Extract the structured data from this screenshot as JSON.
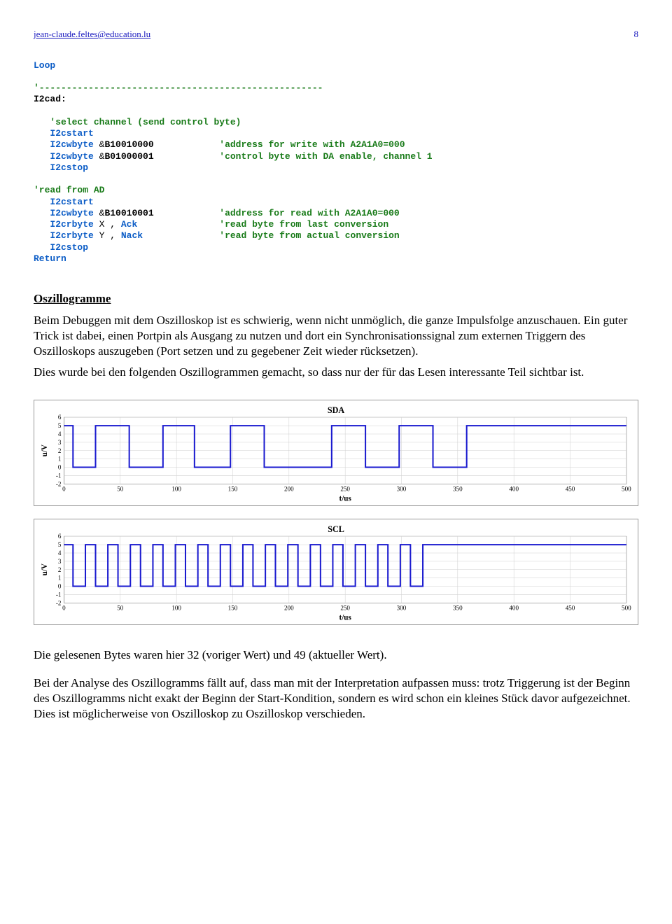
{
  "header": {
    "author_link": "jean-claude.feltes@education.lu",
    "page_number": "8"
  },
  "code": {
    "loop": "Loop",
    "dash": "'----------------------------------------------------",
    "lbl_i2cad": "I2cad:",
    "cmt_select": "'select channel (send control byte)",
    "i2cstart": "I2cstart",
    "i2cwbyte": "I2cwbyte",
    "b1": "B10010000",
    "cmt_addr_w": "'address for write with A2A1A0=000",
    "b2": "B01000001",
    "cmt_ctrl": "'control byte with DA enable, channel 1",
    "i2cstop": "I2cstop",
    "cmt_read": "'read from AD",
    "b3": "B10010001",
    "cmt_addr_r": "'address for read with A2A1A0=000",
    "i2crbyte": "I2crbyte",
    "x": " X",
    "ack": "Ack",
    "cmt_last": "'read byte from last conversion",
    "y": " Y",
    "nack": "Nack",
    "cmt_act": "'read byte from actual conversion",
    "ret": "Return"
  },
  "section_title": "Oszillogramme",
  "paragraphs": {
    "p1": "Beim Debuggen mit dem Oszilloskop ist es schwierig, wenn nicht unmöglich, die ganze Impulsfolge anzuschauen. Ein guter Trick ist dabei, einen Portpin als Ausgang zu nutzen und dort ein Synchronisationssignal zum externen Triggern des Oszilloskops auszugeben (Port setzen und zu gegebener Zeit wieder rücksetzen).",
    "p2": "Dies wurde bei den folgenden Oszillogrammen gemacht, so dass nur der für das Lesen interessante Teil sichtbar ist.",
    "p3": "Die gelesenen Bytes waren hier 32 (voriger Wert) und 49 (aktueller Wert).",
    "p4": "Bei der Analyse des Oszillogramms fällt auf, dass man mit der Interpretation aufpassen muss: trotz Triggerung ist der Beginn des Oszillogramms nicht exakt der Beginn der Start-Kondition, sondern es wird schon ein kleines Stück davor aufgezeichnet. Dies ist möglicherweise von Oszilloskop zu Oszilloskop verschieden."
  },
  "chart_data": [
    {
      "type": "line",
      "title": "SDA",
      "xlabel": "t/us",
      "ylabel": "u/V",
      "xlim": [
        0,
        500
      ],
      "ylim": [
        -2,
        6
      ],
      "y_ticks": [
        -2,
        -1,
        0,
        1,
        2,
        3,
        4,
        5,
        6
      ],
      "x_ticks": [
        0,
        50,
        100,
        150,
        200,
        250,
        300,
        350,
        400,
        450,
        500
      ],
      "edges": [
        {
          "t": 0,
          "v": 5
        },
        {
          "t": 8,
          "v": 0
        },
        {
          "t": 28,
          "v": 5
        },
        {
          "t": 58,
          "v": 0
        },
        {
          "t": 88,
          "v": 5
        },
        {
          "t": 116,
          "v": 0
        },
        {
          "t": 148,
          "v": 5
        },
        {
          "t": 178,
          "v": 0
        },
        {
          "t": 238,
          "v": 5
        },
        {
          "t": 268,
          "v": 0
        },
        {
          "t": 298,
          "v": 5
        },
        {
          "t": 328,
          "v": 0
        },
        {
          "t": 358,
          "v": 5
        },
        {
          "t": 500,
          "v": 5
        }
      ]
    },
    {
      "type": "line",
      "title": "SCL",
      "xlabel": "t/us",
      "ylabel": "u/V",
      "xlim": [
        0,
        500
      ],
      "ylim": [
        -2,
        6
      ],
      "y_ticks": [
        -2,
        -1,
        0,
        1,
        2,
        3,
        4,
        5,
        6
      ],
      "x_ticks": [
        0,
        50,
        100,
        150,
        200,
        250,
        300,
        350,
        400,
        450,
        500
      ],
      "period": 20,
      "first_low": 8,
      "last_low": 328,
      "duty_low": 0.55
    }
  ]
}
